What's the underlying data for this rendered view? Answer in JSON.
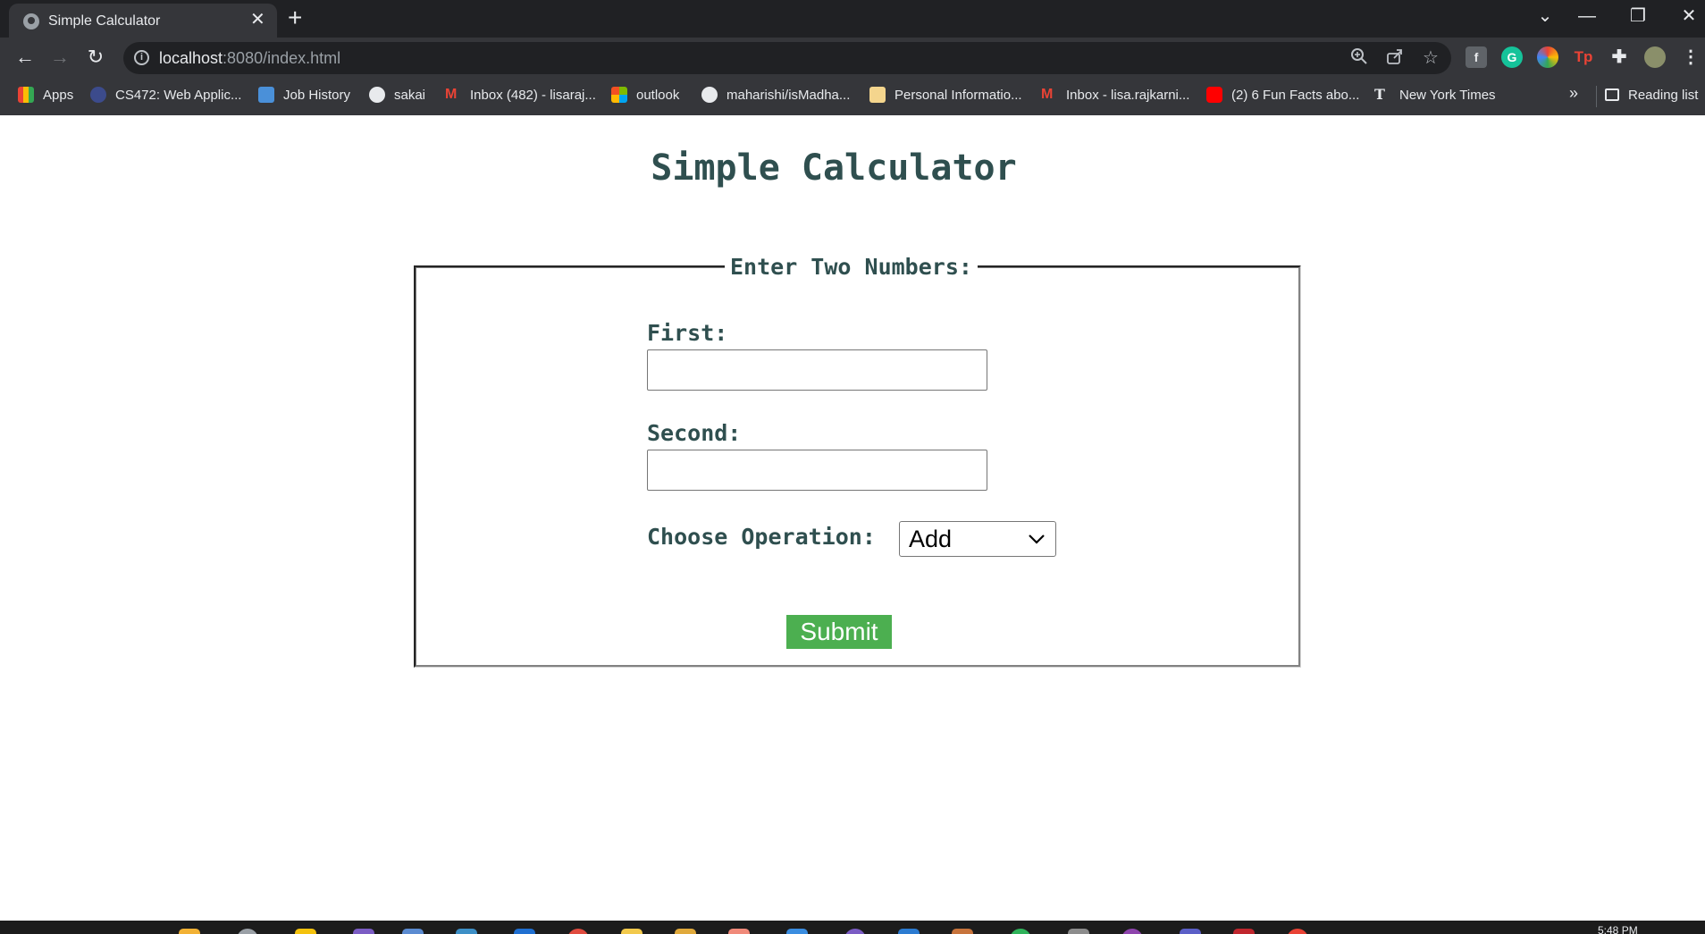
{
  "browser": {
    "tab": {
      "title": "Simple Calculator",
      "close_icon": "close-icon"
    },
    "url": {
      "host": "localhost",
      "rest": ":8080/index.html"
    },
    "window_controls": {
      "minimize": "—",
      "restore": "❐",
      "close": "✕",
      "tab_search": "⌄"
    },
    "bookmarks": [
      {
        "label": "Apps",
        "icon": "apps-grid-icon",
        "color": "#4285f4"
      },
      {
        "label": "CS472: Web Applic...",
        "icon": "globe-icon",
        "color": "#3c4b8c"
      },
      {
        "label": "Job History",
        "icon": "job-icon",
        "color": "#4a90d9"
      },
      {
        "label": "sakai",
        "icon": "globe-icon",
        "color": "#e8eaed"
      },
      {
        "label": "Inbox (482) - lisaraj...",
        "icon": "gmail-icon",
        "color": "#ea4335"
      },
      {
        "label": "outlook",
        "icon": "microsoft-icon",
        "color": "#f25022"
      },
      {
        "label": "maharishi/isMadha...",
        "icon": "github-icon",
        "color": "#e8eaed"
      },
      {
        "label": "Personal Informatio...",
        "icon": "page-icon",
        "color": "#f4d58d"
      },
      {
        "label": "Inbox - lisa.rajkarni...",
        "icon": "gmail-icon",
        "color": "#ea4335"
      },
      {
        "label": "(2) 6 Fun Facts abo...",
        "icon": "youtube-icon",
        "color": "#ff0000"
      },
      {
        "label": "New York Times",
        "icon": "nyt-icon",
        "color": "#e8eaed"
      }
    ],
    "bookmarks_more": "»",
    "reading_list": "Reading list"
  },
  "page": {
    "title": "Simple Calculator",
    "legend": "Enter Two Numbers:",
    "first_label": "First:",
    "first_value": "",
    "second_label": "Second:",
    "second_value": "",
    "operation_label": "Choose Operation:",
    "operation_selected": "Add",
    "submit_label": "Submit"
  },
  "taskbar": {
    "time": "5:48 PM"
  },
  "colors": {
    "heading": "#2f4f4f",
    "submit_bg": "#4caf50",
    "chrome_dark": "#202124",
    "chrome_mid": "#35363a"
  }
}
